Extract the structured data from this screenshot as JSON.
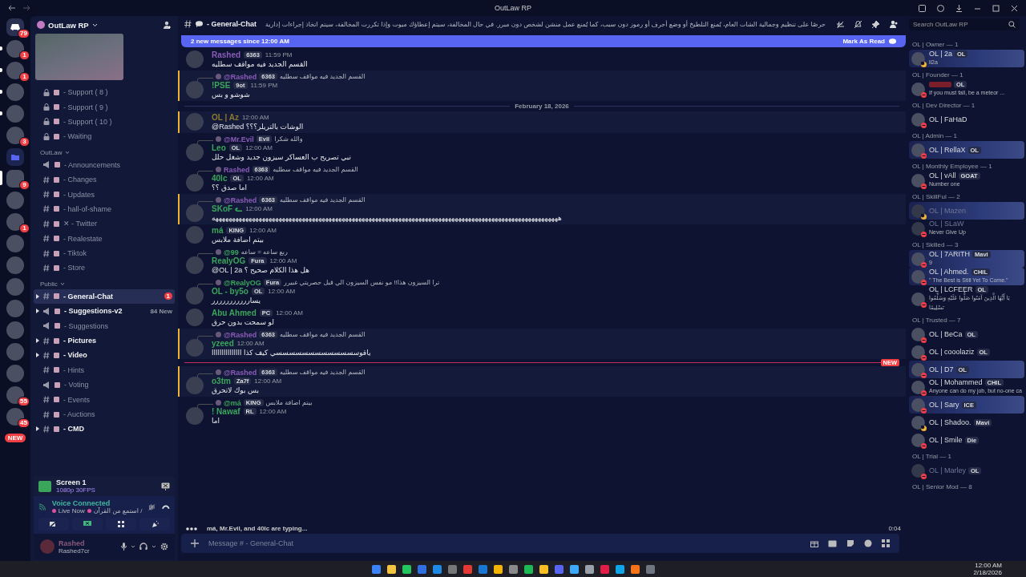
{
  "titlebar": {
    "title": "OutLaw RP"
  },
  "servers": [
    {
      "kind": "home",
      "badge": "79",
      "unread": false,
      "selected": false
    },
    {
      "kind": "server",
      "badge": "1",
      "unread": true,
      "selected": false
    },
    {
      "kind": "server",
      "badge": "1",
      "unread": true,
      "selected": false
    },
    {
      "kind": "server",
      "unread": true,
      "selected": false
    },
    {
      "kind": "server",
      "unread": true,
      "selected": false
    },
    {
      "kind": "server",
      "badge": "3",
      "unread": false,
      "selected": false
    },
    {
      "kind": "folder",
      "unread": false,
      "selected": false
    },
    {
      "kind": "server",
      "badge": "9",
      "unread": false,
      "selected": true
    },
    {
      "kind": "server",
      "unread": false,
      "selected": false
    },
    {
      "kind": "server",
      "badge": "1",
      "unread": false,
      "selected": false
    },
    {
      "kind": "server",
      "unread": false,
      "selected": false
    },
    {
      "kind": "server",
      "unread": false,
      "selected": false
    },
    {
      "kind": "server",
      "unread": false,
      "selected": false
    },
    {
      "kind": "server",
      "unread": false,
      "selected": false
    },
    {
      "kind": "server",
      "unread": false,
      "selected": false
    },
    {
      "kind": "server",
      "unread": false,
      "selected": false
    },
    {
      "kind": "server",
      "unread": false,
      "selected": false
    },
    {
      "kind": "server",
      "badge": "55",
      "unread": false,
      "selected": false
    },
    {
      "kind": "server",
      "badge": "45",
      "unread": false,
      "selected": false
    },
    {
      "kind": "new",
      "badge": "NEW",
      "unread": false,
      "selected": false
    }
  ],
  "server": {
    "name": "OutLaw RP"
  },
  "channel_groups": [
    {
      "items": [
        {
          "kind": "lock",
          "label": "- Support ( 8 )",
          "unread": false,
          "selected": false,
          "threads": false
        },
        {
          "kind": "lock",
          "label": "- Support ( 9 )",
          "unread": false,
          "selected": false,
          "threads": false
        },
        {
          "kind": "lock",
          "label": "- Support ( 10 )",
          "unread": false,
          "selected": false,
          "threads": false
        },
        {
          "kind": "lock",
          "label": "- Waiting",
          "unread": false,
          "selected": false,
          "threads": false
        }
      ]
    },
    {
      "name": "OutLaw",
      "expanded": true,
      "items": [
        {
          "kind": "announce",
          "label": "- Announcements",
          "unread": false,
          "selected": false,
          "threads": false
        },
        {
          "kind": "hash",
          "label": "- Changes",
          "unread": false,
          "selected": false,
          "threads": false
        },
        {
          "kind": "hash",
          "label": "- Updates",
          "unread": false,
          "selected": false,
          "threads": false
        },
        {
          "kind": "hash",
          "label": "- hall-of-shame",
          "unread": false,
          "selected": false,
          "threads": false
        },
        {
          "kind": "hash",
          "label": "✕ - Twitter",
          "unread": false,
          "selected": false,
          "threads": false
        },
        {
          "kind": "hash",
          "label": "- Realestate",
          "unread": false,
          "selected": false,
          "threads": false
        },
        {
          "kind": "hash",
          "label": "- Tiktok",
          "unread": false,
          "selected": false,
          "threads": false
        },
        {
          "kind": "hash",
          "label": "- Store",
          "unread": false,
          "selected": false,
          "threads": false
        }
      ]
    },
    {
      "name": "Public",
      "expanded": true,
      "items": [
        {
          "kind": "hash",
          "label": "- General-Chat",
          "unread": true,
          "selected": true,
          "threads": true,
          "badge": "1"
        },
        {
          "kind": "announce",
          "label": "- Suggestions-v2",
          "unread": true,
          "selected": false,
          "threads": true,
          "new_count": "84 New"
        },
        {
          "kind": "announce",
          "label": "- Suggestions",
          "unread": false,
          "selected": false,
          "threads": false
        },
        {
          "kind": "hash",
          "label": "- Pictures",
          "unread": true,
          "selected": false,
          "threads": true
        },
        {
          "kind": "hash",
          "label": "- Video",
          "unread": true,
          "selected": false,
          "threads": true
        },
        {
          "kind": "hash",
          "label": "- Hints",
          "unread": false,
          "selected": false,
          "threads": false
        },
        {
          "kind": "announce",
          "label": "- Voting",
          "unread": false,
          "selected": false,
          "threads": false
        },
        {
          "kind": "hash",
          "label": "- Events",
          "unread": false,
          "selected": false,
          "threads": false
        },
        {
          "kind": "hash",
          "label": "- Auctions",
          "unread": false,
          "selected": false,
          "threads": false
        },
        {
          "kind": "hash",
          "label": "- CMD",
          "unread": true,
          "selected": false,
          "threads": true
        }
      ]
    }
  ],
  "stream": {
    "title": "Screen 1",
    "quality": "1080p 30FPS"
  },
  "voice": {
    "status": "Voice Connected",
    "live": "Live Now",
    "channel": "استمع من القرآن /"
  },
  "user": {
    "name": "Rashed",
    "tag": "Rashed7cr"
  },
  "chat": {
    "channel": "- General-Chat",
    "topic": "حرصًا على تنظيم وجمالية الشات العام، يُمنع التلطيخ أو وضع أحرف أو رموز دون سبب، كما يُمنع عمل منشن لشخص دون مبرر. في حال المخالفة، سيتم إعطاؤك ميوت وإذا تكررت المخالفة، سيتم اتخاذ إجراءات إدارية",
    "search": {
      "placeholder": "Search OutLaw RP"
    },
    "new_bar": {
      "text": "2 new messages since 12:00 AM",
      "action": "Mark As Read"
    },
    "items": [
      {
        "kind": "message",
        "author": "Rashed",
        "color": "#8a5cb8",
        "tag": "6363",
        "time": "11:59 PM",
        "text": "القسم الجديد فيه مواقف سطليه",
        "mentioned": false
      },
      {
        "kind": "message",
        "reply": {
          "author": "@Rashed",
          "color": "#8a5cb8",
          "tag": "6363",
          "text": "القسم الجديد فيه مواقف سطليه"
        },
        "author": "!PSE",
        "color": "#3ba55c",
        "tag": "9ot",
        "time": "11:59 PM",
        "text": "شوشو و بس",
        "mentioned": true
      },
      {
        "kind": "date_divider",
        "text": "February 18, 2026"
      },
      {
        "kind": "message",
        "author": "OL | Az",
        "color": "#8a7a30",
        "time": "12:00 AM",
        "text": "@Rashed الوشات بالتريلر؟؟؟",
        "mentioned": true
      },
      {
        "kind": "message",
        "reply": {
          "author": "@Mr.Evil",
          "color": "#8a5cb8",
          "tag": "Evil",
          "text": "والله شكرا"
        },
        "author": "Leo",
        "color": "#3ba55c",
        "tag": "OL",
        "time": "12:00 AM",
        "text": "نبي تصريح ب العساكر سيزون جديد وشغل حلل",
        "mentioned": false
      },
      {
        "kind": "message",
        "reply": {
          "author": "Rashed",
          "color": "#8a5cb8",
          "tag": "6363",
          "text": "القسم الجديد فيه مواقف سطليه"
        },
        "author": "40lc",
        "color": "#3ba55c",
        "tag": "OL",
        "time": "12:00 AM",
        "text": "اما صدق ؟؟",
        "mentioned": false
      },
      {
        "kind": "message",
        "reply": {
          "author": "@Rashed",
          "color": "#8a5cb8",
          "tag": "6363",
          "text": "القسم الجديد فيه مواقف سطليه"
        },
        "author": "SKoF ᓚ",
        "color": "#3ba55c",
        "time": "12:00 AM",
        "text": "ههههههههههههههههههههههههههههههههههههههههههههههههههههههههههههههههههههههههههههههههههههههههههههههههههههههههه",
        "mentioned": true
      },
      {
        "kind": "message",
        "author": "má",
        "color": "#3ba55c",
        "tag": "KING",
        "time": "12:00 AM",
        "text": "بيتم اضافة ملابس",
        "mentioned": false
      },
      {
        "kind": "message",
        "reply": {
          "author": "@99",
          "color": "#3ba55c",
          "text": "ربع ساعه = ساعه"
        },
        "author": "RealyOG",
        "color": "#3ba55c",
        "tag": "Fura",
        "time": "12:00 AM",
        "text": "@OL | 2a هل هذا الكلام صحيح ؟",
        "mentioned": false
      },
      {
        "kind": "message",
        "reply": {
          "author": "@RealyOG",
          "color": "#3ba55c",
          "tag": "Fura",
          "text": "ترا السيزون هذا!! مو نفس السيزون الي قبل حصريتي غبيرر"
        },
        "author": "OL - by5o",
        "color": "#3ba55c",
        "tag": "OL",
        "time": "12:00 AM",
        "text": "يساررررررررررر",
        "mentioned": false
      },
      {
        "kind": "message",
        "author": "Abu Ahmed",
        "color": "#3ba55c",
        "tag": "PC",
        "time": "12:00 AM",
        "text": "لو سمحت بدون حرق",
        "mentioned": false
      },
      {
        "kind": "message",
        "reply": {
          "author": "@Rashed",
          "color": "#8a5cb8",
          "tag": "6363",
          "text": "القسم الجديد فيه مواقف سطليه"
        },
        "author": "yzeed",
        "color": "#3ba55c",
        "time": "12:00 AM",
        "text": "ياقوسسسسسسسسسسسسسي كيف كذا ااااااااااااااا",
        "mentioned": true
      },
      {
        "kind": "new_divider",
        "text": "NEW"
      },
      {
        "kind": "message",
        "reply": {
          "author": "@Rashed",
          "color": "#8a5cb8",
          "tag": "6363",
          "text": "القسم الجديد فيه مواقف سطليه"
        },
        "author": "o3tm",
        "color": "#3ba55c",
        "tag": "Za7f",
        "time": "12:00 AM",
        "text": "بس بوك لاتحرق",
        "mentioned": true
      },
      {
        "kind": "message",
        "reply": {
          "author": "@má",
          "color": "#3ba55c",
          "tag": "KING",
          "text": "بيتم اضافة ملابس"
        },
        "author": "! Nawaf",
        "color": "#3ba55c",
        "tag": "RL",
        "time": "12:00 AM",
        "text": "اما",
        "mentioned": false
      }
    ],
    "typing": "má, Mr.Evil, and 40lc are typing...",
    "timer": "0:04",
    "input": {
      "placeholder": "Message # - General-Chat"
    }
  },
  "member_groups": [
    {
      "title": "OL | Owner — 1",
      "members": [
        {
          "name": "OL | 2a",
          "tag": "OL",
          "activity": "li2a",
          "kind": "idle",
          "dimmed": false,
          "banner": true
        }
      ]
    },
    {
      "title": "OL | Founder — 1",
      "members": [
        {
          "tag": "OL",
          "activity": "If you must fall, be a meteor ...",
          "kind": "dnd",
          "dimmed": false,
          "banner": false
        }
      ]
    },
    {
      "title": "OL | Dev Director — 1",
      "members": [
        {
          "name": "OL | FaHaD",
          "kind": "dnd",
          "dimmed": false,
          "banner": false
        }
      ]
    },
    {
      "title": "OL | Admin — 1",
      "members": [
        {
          "name": "OL | RellaX",
          "tag": "OL",
          "kind": "dnd",
          "dimmed": false,
          "banner": true
        }
      ]
    },
    {
      "title": "OL | Monthly Employee — 1",
      "members": [
        {
          "name": "OL | vAll",
          "tag": "GOAT",
          "activity": "Number one",
          "kind": "dnd",
          "dimmed": false,
          "banner": false
        }
      ]
    },
    {
      "title": "OL | SkillFul — 2",
      "members": [
        {
          "name": "OL | Mazen",
          "kind": "idle",
          "dimmed": true,
          "banner": true
        },
        {
          "name": "OL | SLaW",
          "activity": "Never Give Up",
          "kind": "dnd",
          "dimmed": true,
          "banner": false
        }
      ]
    },
    {
      "title": "OL | Skilled — 3",
      "members": [
        {
          "name": "OL | 7ARITH",
          "tag": "Mavi",
          "activity": "9",
          "kind": "dnd",
          "dimmed": false,
          "banner": true
        },
        {
          "name": "OL | Ahmed.",
          "tag": "CHIL",
          "activity": "\" The Best is Still Yet To Come.\"",
          "kind": "dnd",
          "dimmed": false,
          "banner": true
        },
        {
          "name": "OL | LCFEER",
          "tag": "OL",
          "activity": "يَا أَيُّهَا الَّذِينَ آمَنُوا صَلُّوا عَلَيْهِ وَسَلِّمُوا تَسْلِيمًا",
          "kind": "dnd",
          "dimmed": false,
          "banner": false
        }
      ]
    },
    {
      "title": "OL | Trusted — 7",
      "members": [
        {
          "name": "OL | BeCa",
          "tag": "OL",
          "kind": "dnd",
          "dimmed": false,
          "banner": false
        },
        {
          "name": "OL | cooolaziz",
          "tag": "OL",
          "kind": "dnd",
          "dimmed": false,
          "banner": false
        },
        {
          "name": "OL | D7",
          "tag": "OL",
          "kind": "dnd",
          "dimmed": false,
          "banner": true
        },
        {
          "name": "OL | Mohammed",
          "tag": "CHIL",
          "activity": "Anyone can do my job, but no-one ca",
          "kind": "dnd",
          "dimmed": false,
          "banner": false
        },
        {
          "name": "OL | Sary",
          "tag": "ICE",
          "kind": "dnd",
          "dimmed": false,
          "banner": true
        },
        {
          "name": "OL | Shadoo.",
          "tag": "Mavi",
          "kind": "idle",
          "dimmed": false,
          "banner": false
        },
        {
          "name": "OL | Smile",
          "tag": "Die",
          "kind": "dnd",
          "dimmed": false,
          "banner": false
        }
      ]
    },
    {
      "title": "OL | Trial — 1",
      "members": [
        {
          "name": "OL | Marley",
          "tag": "OL",
          "kind": "dnd",
          "dimmed": true,
          "banner": false
        }
      ]
    },
    {
      "title": "OL | Senior Mod — 8"
    }
  ],
  "taskbar": {
    "time": "12:00 AM",
    "date": "2/18/2026"
  }
}
